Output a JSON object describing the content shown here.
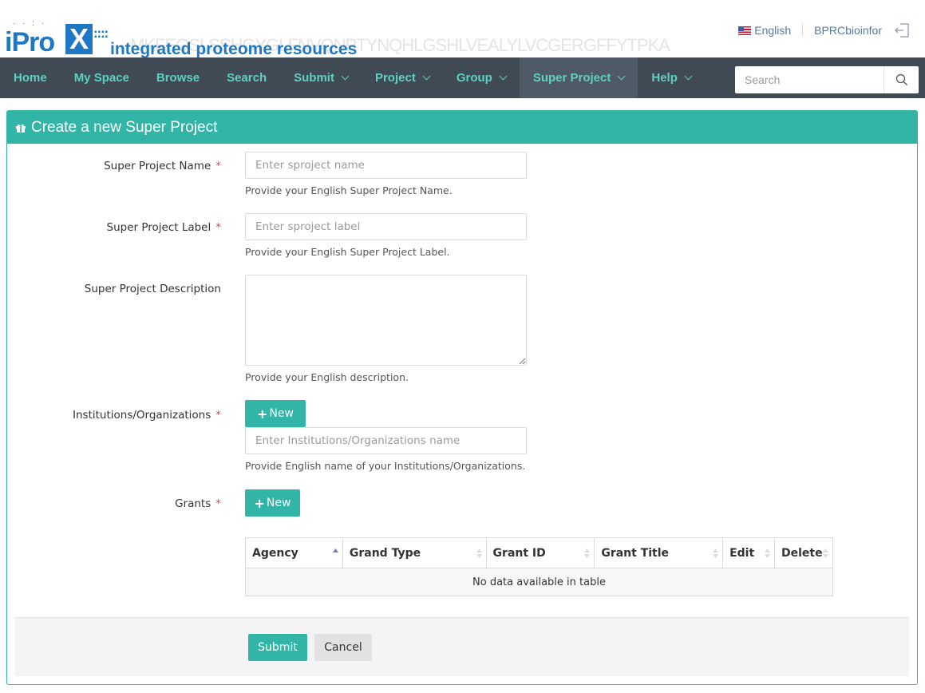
{
  "header": {
    "bg_sequence": "…MKFEGSLSSHGYGLFNVQNPTYNQHLGSHLVEALYLVCGERGFFYTPKA",
    "logo_main": "iPro",
    "logo_x": "X",
    "logo_sub": "integrated proteome resources",
    "language": "English",
    "username": "BPRCbioinfor"
  },
  "nav": {
    "items": [
      {
        "label": "Home"
      },
      {
        "label": "My Space"
      },
      {
        "label": "Browse"
      },
      {
        "label": "Search"
      },
      {
        "label": "Submit"
      },
      {
        "label": "Project"
      },
      {
        "label": "Group"
      },
      {
        "label": "Super Project"
      },
      {
        "label": "Help"
      }
    ],
    "search_placeholder": "Search"
  },
  "panel": {
    "title": "Create a new Super Project"
  },
  "form": {
    "required_mark": "*",
    "name": {
      "label": "Super Project Name",
      "placeholder": "Enter sproject name",
      "help": "Provide your English Super Project Name."
    },
    "label_field": {
      "label": "Super Project Label",
      "placeholder": "Enter sproject label",
      "help": "Provide your English Super Project Label."
    },
    "description": {
      "label": "Super Project Description",
      "help": "Provide your English description."
    },
    "institutions": {
      "label": "Institutions/Organizations",
      "new_button": "New",
      "placeholder": "Enter Institutions/Organizations name",
      "help": "Provide English name of your Institutions/Organizations."
    },
    "grants": {
      "label": "Grants",
      "new_button": "New",
      "columns": [
        "Agency",
        "Grand Type",
        "Grant ID",
        "Grant Title",
        "Edit",
        "Delete"
      ],
      "empty_message": "No data available in table"
    }
  },
  "footer": {
    "submit": "Submit",
    "cancel": "Cancel"
  },
  "colors": {
    "accent": "#32b5a6",
    "navbar": "#3f4a55",
    "nav_text": "#5fd0c2",
    "brand_blue": "#1f78c6",
    "required": "#e4473b"
  }
}
